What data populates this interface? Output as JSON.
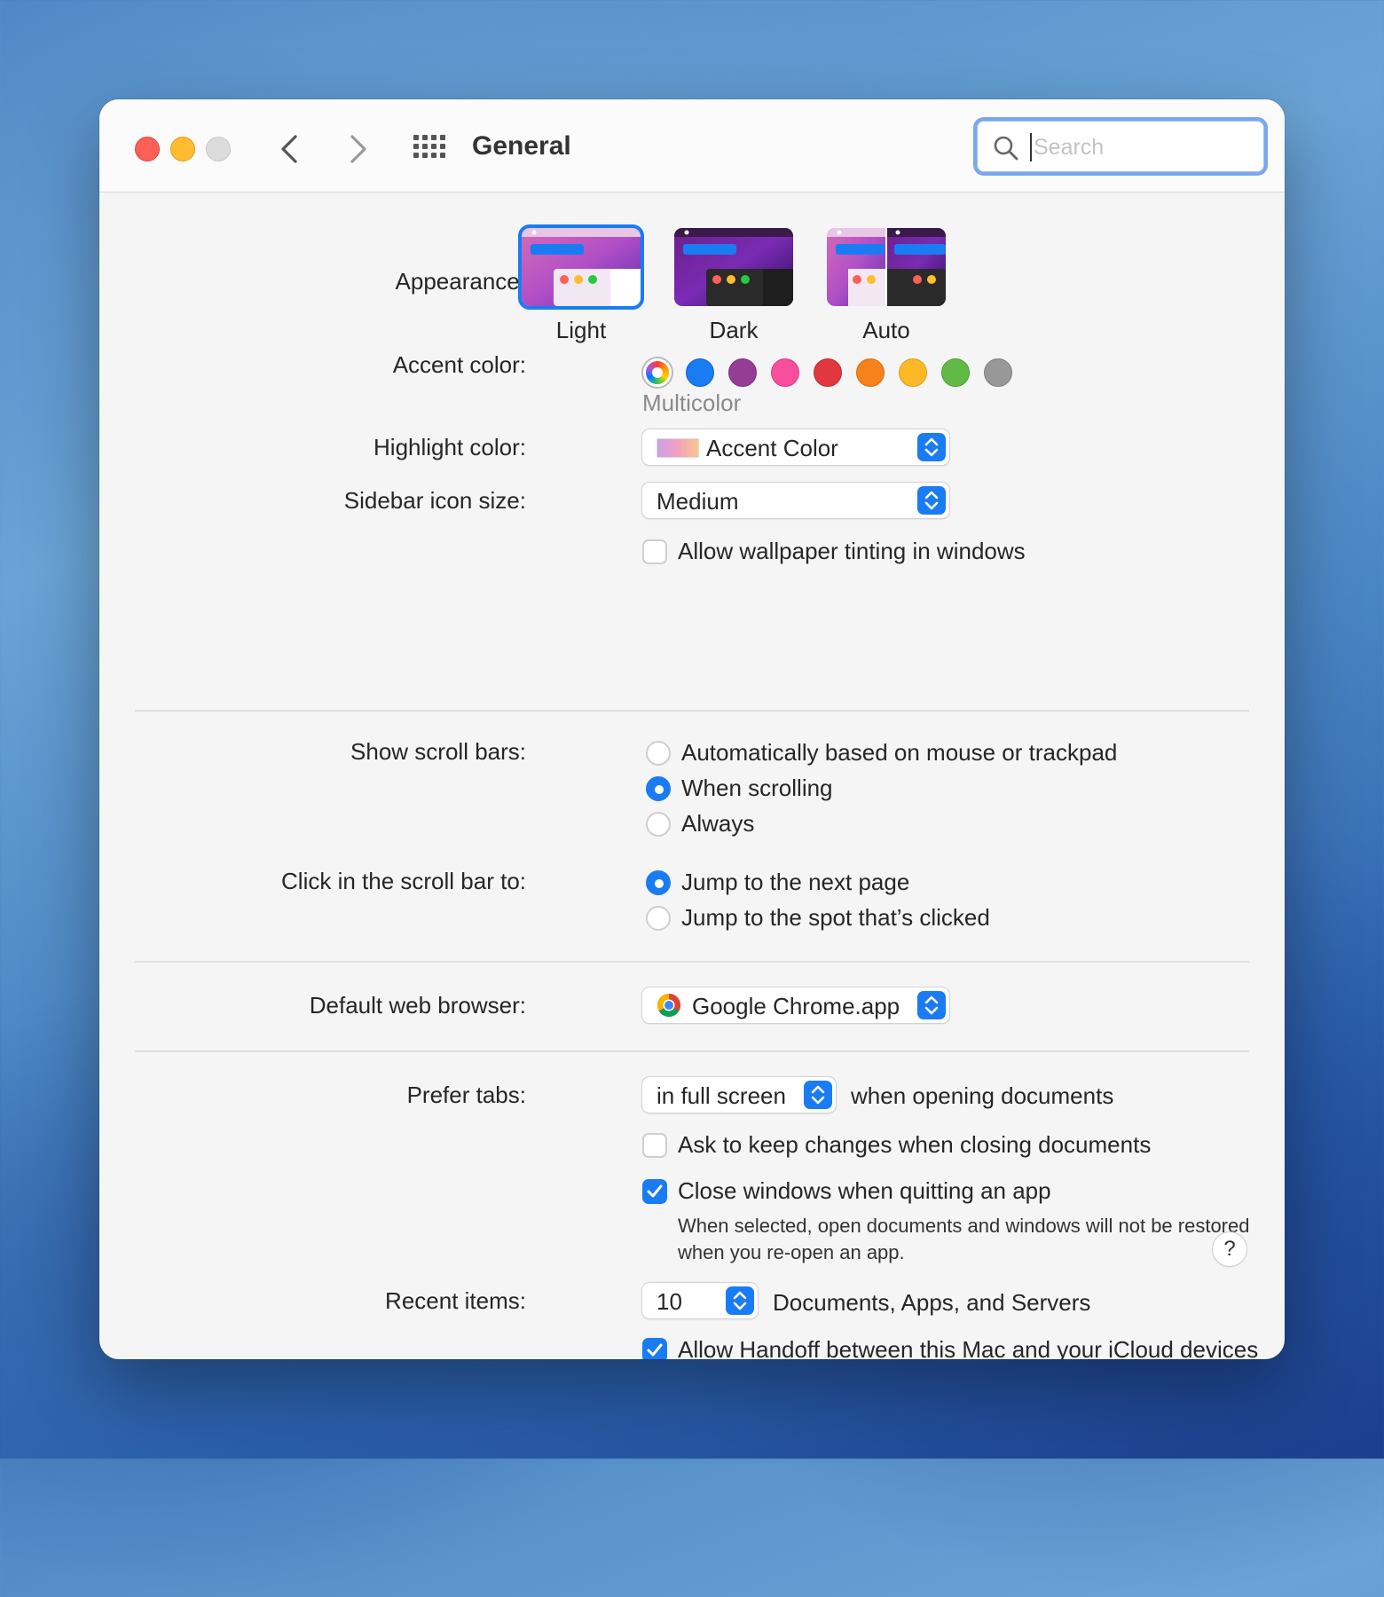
{
  "window": {
    "title": "General"
  },
  "search": {
    "placeholder": "Search"
  },
  "appearance": {
    "label": "Appearance:",
    "options": [
      {
        "name": "Light",
        "selected": true
      },
      {
        "name": "Dark",
        "selected": false
      },
      {
        "name": "Auto",
        "selected": false
      }
    ]
  },
  "accent": {
    "label": "Accent color:",
    "selected_name": "Multicolor",
    "colors": [
      "multicolor",
      "#1a7cf2",
      "#953d96",
      "#f74f9e",
      "#e0383e",
      "#f7821b",
      "#fcb827",
      "#62ba46",
      "#989898"
    ]
  },
  "highlight": {
    "label": "Highlight color:",
    "value": "Accent Color"
  },
  "sidebar_icon": {
    "label": "Sidebar icon size:",
    "value": "Medium"
  },
  "wallpaper_tint": {
    "label": "Allow wallpaper tinting in windows",
    "checked": false
  },
  "scroll_bars": {
    "label": "Show scroll bars:",
    "options": [
      {
        "label": "Automatically based on mouse or trackpad",
        "selected": false
      },
      {
        "label": "When scrolling",
        "selected": true
      },
      {
        "label": "Always",
        "selected": false
      }
    ]
  },
  "scroll_click": {
    "label": "Click in the scroll bar to:",
    "options": [
      {
        "label": "Jump to the next page",
        "selected": true
      },
      {
        "label": "Jump to the spot that’s clicked",
        "selected": false
      }
    ]
  },
  "browser": {
    "label": "Default web browser:",
    "value": "Google Chrome.app"
  },
  "tabs": {
    "label": "Prefer tabs:",
    "value": "in full screen",
    "suffix": "when opening documents"
  },
  "ask_keep": {
    "label": "Ask to keep changes when closing documents",
    "checked": false
  },
  "close_windows": {
    "label": "Close windows when quitting an app",
    "checked": true,
    "note": "When selected, open documents and windows will not be restored when you re-open an app."
  },
  "recent": {
    "label": "Recent items:",
    "value": "10",
    "suffix": "Documents, Apps, and Servers"
  },
  "handoff": {
    "label": "Allow Handoff between this Mac and your iCloud devices",
    "checked": true
  },
  "help": {
    "label": "?"
  },
  "colors": {
    "accent": "#1a7cf2",
    "window_bg": "#f5f5f5"
  }
}
